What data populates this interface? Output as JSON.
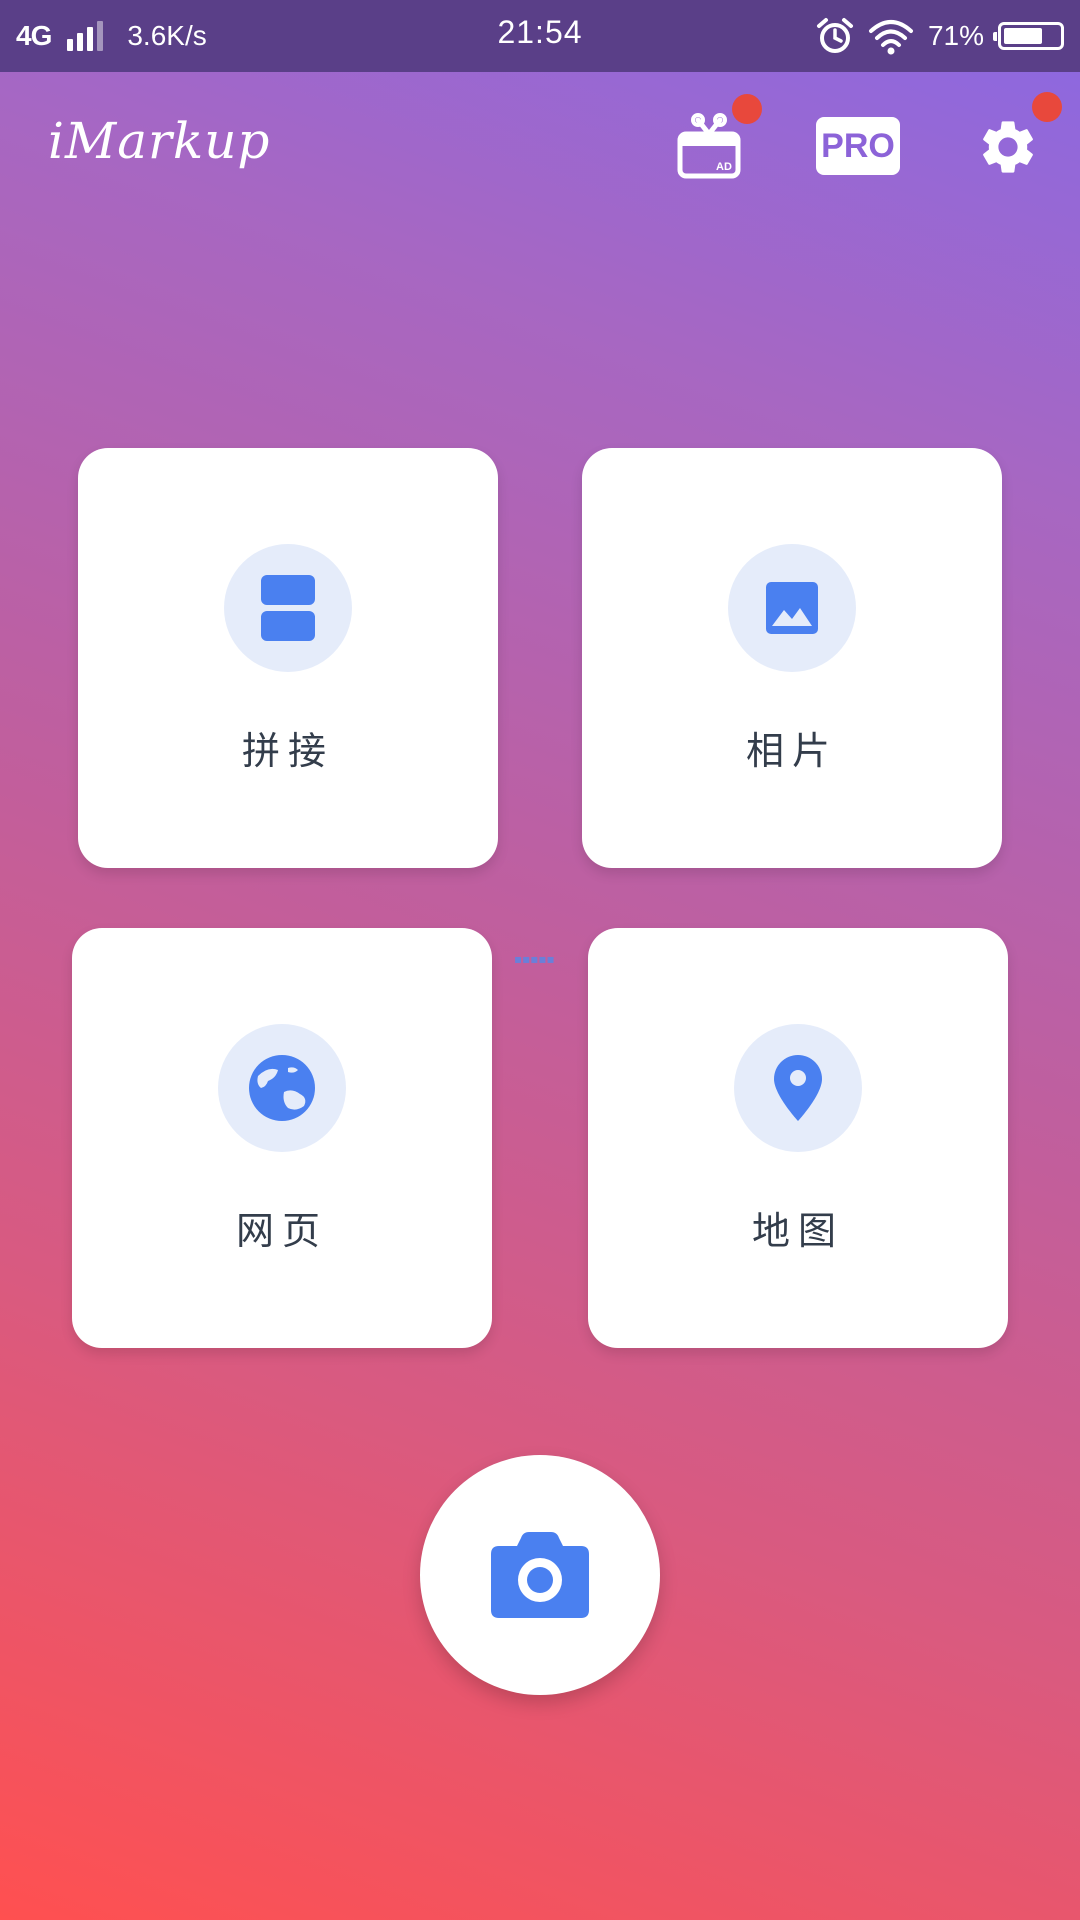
{
  "status_bar": {
    "network": "4G",
    "speed": "3.6K/s",
    "time": "21:54",
    "battery_percent": "71%",
    "battery_level": 0.71
  },
  "header": {
    "title": "iMarkup",
    "ad_badge": "AD",
    "pro_label": "PRO",
    "icons": [
      "gift-ad-icon",
      "gear-icon"
    ]
  },
  "cards": [
    {
      "label": "拼接",
      "icon": "stitch-icon"
    },
    {
      "label": "相片",
      "icon": "image-icon"
    },
    {
      "label": "网页",
      "icon": "globe-icon"
    },
    {
      "label": "地图",
      "icon": "map-pin-icon"
    }
  ],
  "fab": {
    "icon": "camera-icon"
  },
  "colors": {
    "accent_blue": "#4a80f0",
    "icon_bg": "#e5ecfa",
    "notification_dot": "#e8483c",
    "status_bar_bg": "#5a3f88"
  }
}
